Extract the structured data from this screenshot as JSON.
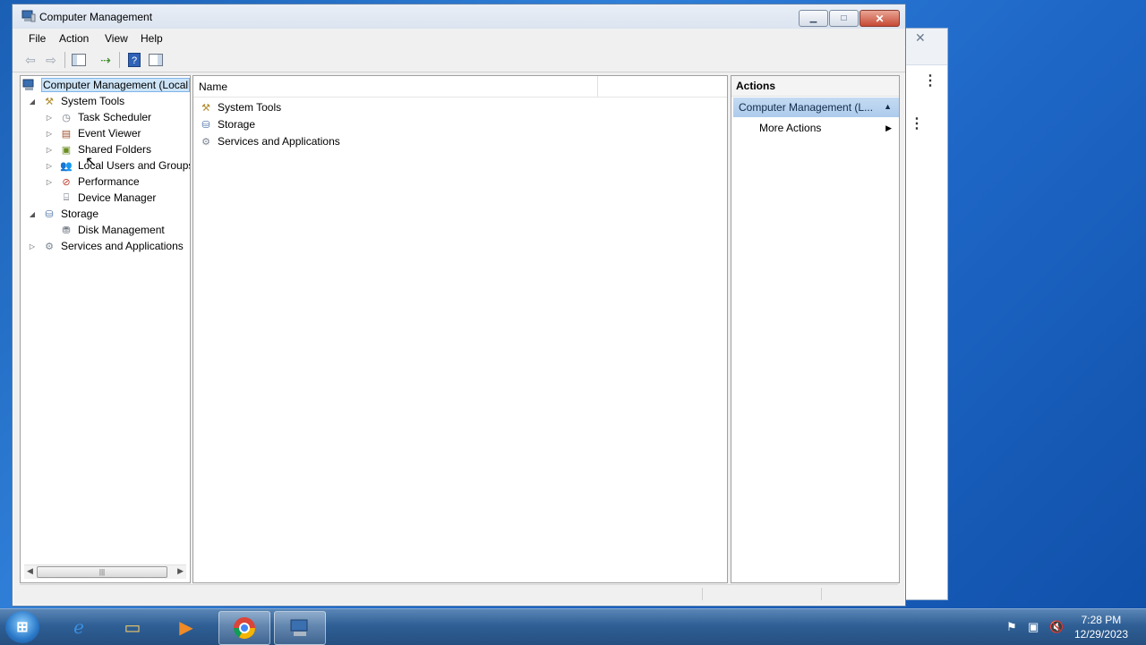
{
  "window": {
    "title": "Computer Management",
    "minimize_symbol": "▁",
    "maximize_symbol": "□",
    "close_symbol": "✕"
  },
  "menu": [
    "File",
    "Action",
    "View",
    "Help"
  ],
  "tree": {
    "root": "Computer Management (Local",
    "items": [
      {
        "label": "System Tools",
        "level": 1,
        "expander": "◢",
        "icon": "tools-icon"
      },
      {
        "label": "Task Scheduler",
        "level": 2,
        "expander": "▷",
        "icon": "clock-icon"
      },
      {
        "label": "Event Viewer",
        "level": 2,
        "expander": "▷",
        "icon": "event-viewer-icon"
      },
      {
        "label": "Shared Folders",
        "level": 2,
        "expander": "▷",
        "icon": "shared-folder-icon"
      },
      {
        "label": "Local Users and Groups",
        "level": 2,
        "expander": "▷",
        "icon": "users-icon"
      },
      {
        "label": "Performance",
        "level": 2,
        "expander": "▷",
        "icon": "performance-icon"
      },
      {
        "label": "Device Manager",
        "level": 2,
        "expander": "",
        "icon": "device-manager-icon"
      },
      {
        "label": "Storage",
        "level": 1,
        "expander": "◢",
        "icon": "storage-icon"
      },
      {
        "label": "Disk Management",
        "level": 2,
        "expander": "",
        "icon": "disk-icon"
      },
      {
        "label": "Services and Applications",
        "level": 1,
        "expander": "▷",
        "icon": "services-icon"
      }
    ]
  },
  "list": {
    "column_name": "Name",
    "items": [
      "System Tools",
      "Storage",
      "Services and Applications"
    ]
  },
  "actions": {
    "header": "Actions",
    "section": "Computer Management (L...",
    "more": "More Actions"
  },
  "taskbar": {
    "time": "7:28 PM",
    "date": "12/29/2023"
  },
  "colors": {
    "selection": "#cde4f7",
    "actions_section": "#b8d2ef"
  }
}
